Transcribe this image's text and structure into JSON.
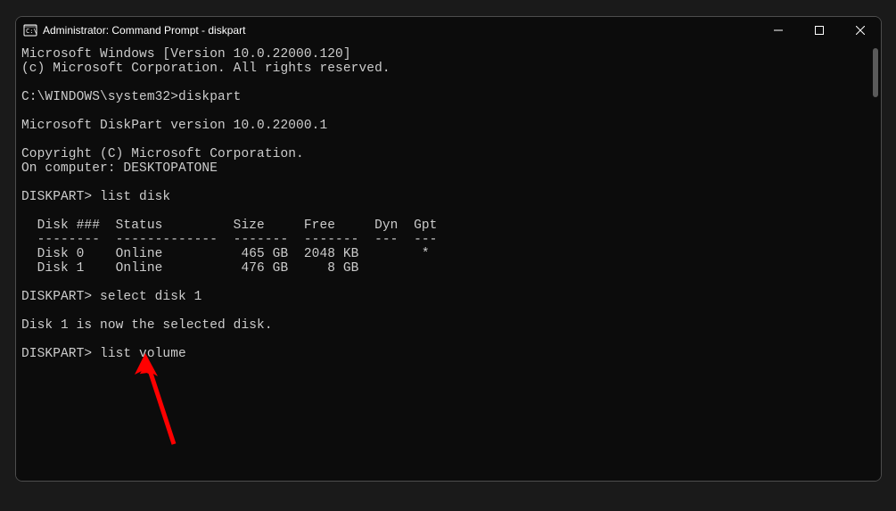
{
  "window": {
    "title": "Administrator: Command Prompt - diskpart"
  },
  "terminal": {
    "lines": [
      "Microsoft Windows [Version 10.0.22000.120]",
      "(c) Microsoft Corporation. All rights reserved.",
      "",
      "C:\\WINDOWS\\system32>diskpart",
      "",
      "Microsoft DiskPart version 10.0.22000.1",
      "",
      "Copyright (C) Microsoft Corporation.",
      "On computer: DESKTOPATONE",
      "",
      "DISKPART> list disk",
      "",
      "  Disk ###  Status         Size     Free     Dyn  Gpt",
      "  --------  -------------  -------  -------  ---  ---",
      "  Disk 0    Online          465 GB  2048 KB        *",
      "  Disk 1    Online          476 GB     8 GB",
      "",
      "DISKPART> select disk 1",
      "",
      "Disk 1 is now the selected disk.",
      "",
      "DISKPART> list volume"
    ]
  }
}
